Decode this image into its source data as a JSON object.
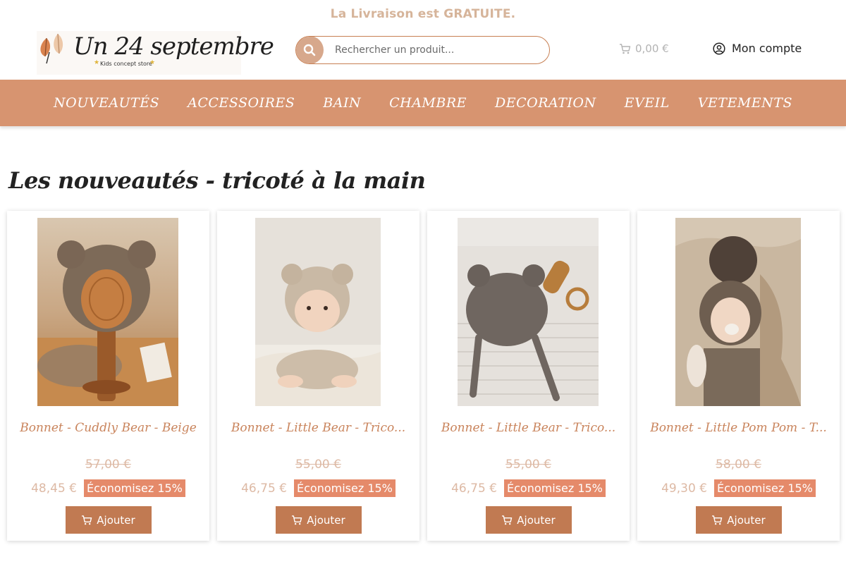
{
  "promo": {
    "text": "La Livraison est GRATUITE."
  },
  "brand": {
    "name": "Un 24 septembre",
    "tagline": "Kids concept store"
  },
  "search": {
    "placeholder": "Rechercher un produit..."
  },
  "cart": {
    "total": "0,00 €"
  },
  "account": {
    "label": "Mon compte"
  },
  "nav": {
    "items": [
      {
        "label": "NOUVEAUTÉS"
      },
      {
        "label": "ACCESSOIRES"
      },
      {
        "label": "BAIN"
      },
      {
        "label": "CHAMBRE"
      },
      {
        "label": "DECORATION"
      },
      {
        "label": "EVEIL"
      },
      {
        "label": "VETEMENTS"
      }
    ]
  },
  "section": {
    "title": "Les nouveautés - tricoté à la main"
  },
  "products": [
    {
      "name": "Bonnet - Cuddly Bear - Beige",
      "old_price": "57,00 €",
      "new_price": "48,45 €",
      "discount": "Économisez 15%",
      "add_label": "Ajouter"
    },
    {
      "name": "Bonnet - Little Bear - Trico...",
      "old_price": "55,00 €",
      "new_price": "46,75 €",
      "discount": "Économisez 15%",
      "add_label": "Ajouter"
    },
    {
      "name": "Bonnet - Little Bear - Trico...",
      "old_price": "55,00 €",
      "new_price": "46,75 €",
      "discount": "Économisez 15%",
      "add_label": "Ajouter"
    },
    {
      "name": "Bonnet - Little Pom Pom - T...",
      "old_price": "58,00 €",
      "new_price": "49,30 €",
      "discount": "Économisez 15%",
      "add_label": "Ajouter"
    }
  ],
  "colors": {
    "accent": "#d79470",
    "button": "#c17a52",
    "badge": "#e58a6a",
    "promo_text": "#d6b49a"
  },
  "icons": {
    "search": "search-icon",
    "cart": "cart-icon",
    "account": "user-circle-icon",
    "add": "cart-icon"
  }
}
